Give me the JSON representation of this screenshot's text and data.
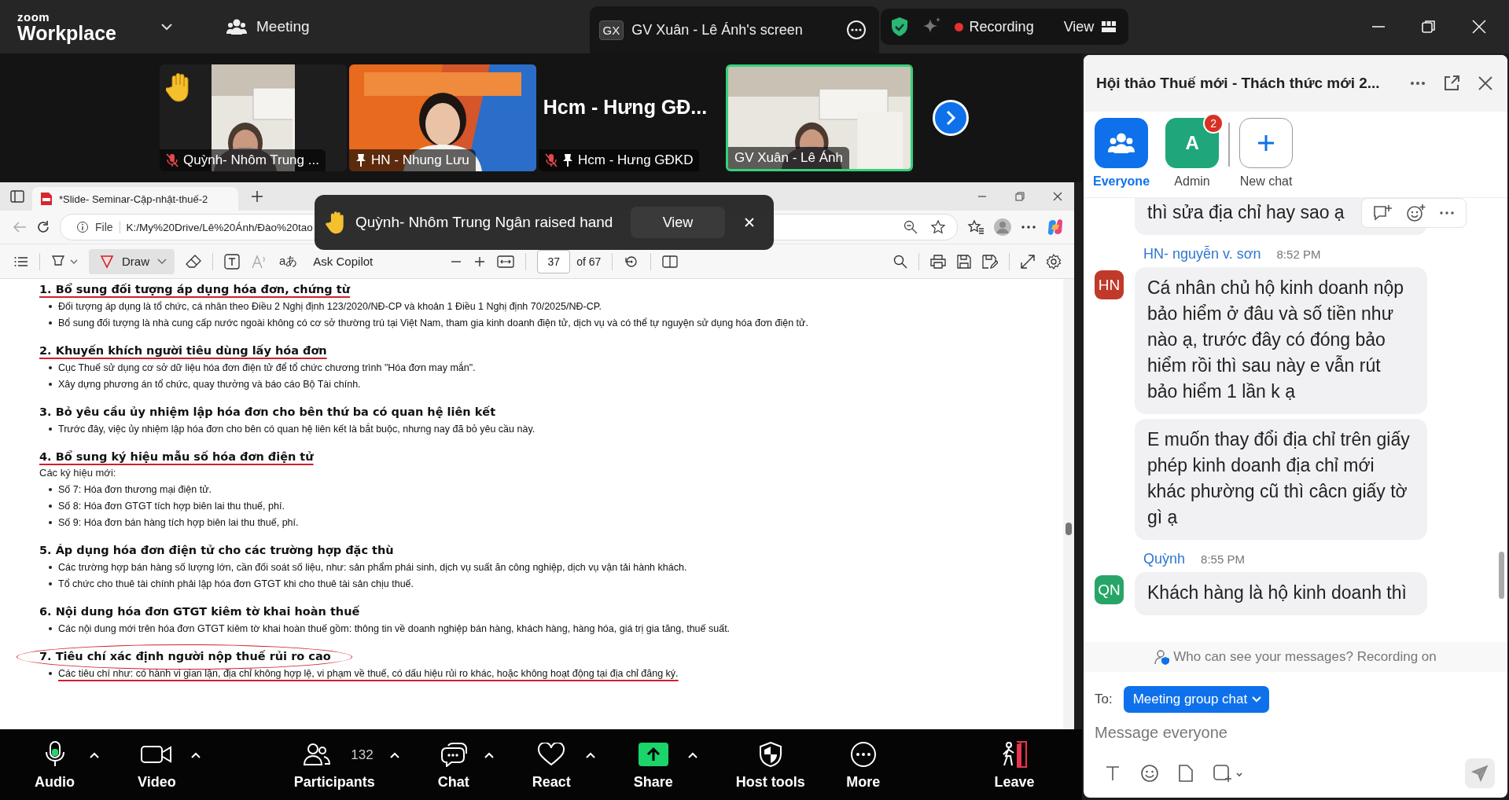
{
  "app": {
    "logo_top": "zoom",
    "logo_bottom": "Workplace",
    "menu": "Meeting",
    "share_tab": {
      "initials": "GX",
      "title": "GV Xuân - Lê Ánh's screen"
    },
    "recording": "Recording",
    "view": "View"
  },
  "thumbnails": [
    {
      "kind": "video",
      "name": "Quỳnh- Nhôm Trung ...",
      "raised_hand": true,
      "muted": true,
      "pinned": false,
      "active": false
    },
    {
      "kind": "video",
      "name": "HN - Nhung Lưu",
      "raised_hand": false,
      "muted": false,
      "pinned": true,
      "active": false
    },
    {
      "kind": "name",
      "display": "Hcm - Hưng GĐ...",
      "name": "Hcm - Hưng GĐKD",
      "raised_hand": false,
      "muted": true,
      "pinned": true,
      "active": false
    },
    {
      "kind": "video",
      "name": "GV Xuân - Lê Ánh",
      "raised_hand": false,
      "muted": false,
      "pinned": false,
      "active": true
    }
  ],
  "browser": {
    "tab_title": "*Slide- Seminar-Cập-nhật-thuế-2",
    "url_label": "File",
    "url": "K:/My%20Drive/Lê%20Ánh/Đào%20tao"
  },
  "pdf_toolbar": {
    "draw": "Draw",
    "read_aloud": "aあ",
    "copilot": "Ask Copilot",
    "page": "37",
    "of_pages": "of 67"
  },
  "toast": {
    "text": "Quỳnh- Nhôm Trung Ngân raised hand",
    "button": "View"
  },
  "sections": [
    {
      "heading": "1. Bổ sung đối tượng áp dụng hóa đơn, chứng từ",
      "underlined": true,
      "circled": false,
      "bullets": [
        {
          "text": "Đối tượng áp dụng là tổ chức, cá nhân theo Điều 2 Nghị định 123/2020/NĐ-CP và khoản 1 Điều 1 Nghị định 70/2025/NĐ-CP.",
          "underlined": false
        },
        {
          "text": "Bổ sung đối tượng là nhà cung cấp nước ngoài không có cơ sở thường trú tại Việt Nam, tham gia kinh doanh điện tử, dịch vụ và có thể tự nguyện sử dụng hóa đơn điện tử.",
          "underlined": false
        }
      ]
    },
    {
      "heading": "2. Khuyến khích người tiêu dùng lấy hóa đơn",
      "underlined": true,
      "circled": false,
      "bullets": [
        {
          "text": "Cục Thuế sử dụng cơ sở dữ liệu hóa đơn điện tử để tổ chức chương trình \"Hóa đơn may mắn\".",
          "underlined": false
        },
        {
          "text": "Xây dựng phương án tổ chức, quay thưởng và báo cáo Bộ Tài chính.",
          "underlined": false
        }
      ]
    },
    {
      "heading": "3. Bỏ yêu cầu ủy nhiệm lập hóa đơn cho bên thứ ba có quan hệ liên kết",
      "underlined": false,
      "circled": false,
      "bullets": [
        {
          "text": "Trước đây, việc ủy nhiệm lập hóa đơn cho bên có quan hệ liên kết là bắt buộc, nhưng nay đã bỏ yêu cầu này.",
          "underlined": false
        }
      ]
    },
    {
      "heading": "4. Bổ sung ký hiệu mẫu số hóa đơn điện tử",
      "underlined": true,
      "circled": false,
      "intro": "Các ký hiệu mới:",
      "bullets": [
        {
          "text": "Số 7: Hóa đơn thương mại điện tử.",
          "underlined": false
        },
        {
          "text": "Số 8: Hóa đơn GTGT tích hợp biên lai thu thuế, phí.",
          "underlined": false
        },
        {
          "text": "Số 9: Hóa đơn bán hàng tích hợp biên lai thu thuế, phí.",
          "underlined": false
        }
      ]
    },
    {
      "heading": "5. Áp dụng hóa đơn điện tử cho các trường hợp đặc thù",
      "underlined": false,
      "circled": false,
      "bullets": [
        {
          "text": "Các trường hợp bán hàng số lượng lớn, cần đối soát số liệu, như: sản phẩm phái sinh, dịch vụ suất ăn công nghiệp, dịch vụ vận tải hành khách.",
          "underlined": false
        },
        {
          "text": "Tổ chức cho thuê tài chính phải lập hóa đơn GTGT khi cho thuê tài sản chịu thuế.",
          "underlined": false
        }
      ]
    },
    {
      "heading": "6. Nội dung hóa đơn GTGT kiêm tờ khai hoàn thuế",
      "underlined": false,
      "circled": false,
      "bullets": [
        {
          "text": "Các nội dung mới trên hóa đơn GTGT kiêm tờ khai hoàn thuế gồm: thông tin về doanh nghiệp bán hàng, khách hàng, hàng hóa, giá trị gia tăng, thuế suất.",
          "underlined": false
        }
      ]
    },
    {
      "heading": "7. Tiêu chí xác định người nộp thuế rủi ro cao",
      "underlined": false,
      "circled": true,
      "bullets": [
        {
          "text": "Các tiêu chí như: có hành vi gian lận, địa chỉ không hợp lệ, vi phạm về thuế, có dấu hiệu rủi ro khác, hoặc không hoạt động tại địa chỉ đăng ký.",
          "underlined": true
        }
      ]
    }
  ],
  "chat": {
    "title": "Hội thảo Thuế mới - Thách thức mới 2...",
    "tabs": [
      {
        "kind": "group",
        "label": "Everyone",
        "selected": true
      },
      {
        "kind": "avatar",
        "initial": "A",
        "badge": "2",
        "label": "Admin",
        "selected": false
      },
      {
        "kind": "new",
        "label": "New chat",
        "selected": false
      }
    ],
    "messages": [
      {
        "text": "thì sửa địa chỉ hay sao ạ"
      },
      {
        "sender": "HN- nguyễn v. sơn",
        "time": "8:52 PM",
        "initials": "HN",
        "color": "#c0392b",
        "text": "Cá nhân chủ hộ kinh doanh nộp bảo hiểm ở đâu và số tiền như nào ạ, trước đây có đóng bảo hiểm rồi thì sau này e vẫn rút bảo hiểm 1 lần k ạ"
      },
      {
        "text": "E muốn thay đổi địa chỉ trên giấy phép kinh doanh địa chỉ mới khác phường cũ thì câcn giấy tờ gì ạ"
      },
      {
        "sender": "Quỳnh",
        "time": "8:55 PM",
        "initials": "QN",
        "color": "#27a567",
        "text": "Khách hàng là hộ kinh doanh thì"
      }
    ],
    "notice": "Who can see your messages? Recording on",
    "to_label": "To:",
    "to": "Meeting group chat",
    "placeholder": "Message everyone"
  },
  "toolbar": [
    {
      "kind": "audio",
      "label": "Audio",
      "caret": true
    },
    {
      "kind": "video",
      "label": "Video",
      "caret": true
    },
    {
      "kind": "participants",
      "label": "Participants",
      "count": "132",
      "caret": true
    },
    {
      "kind": "chat",
      "label": "Chat",
      "caret": true
    },
    {
      "kind": "react",
      "label": "React",
      "caret": true
    },
    {
      "kind": "share",
      "label": "Share",
      "caret": true
    },
    {
      "kind": "host",
      "label": "Host tools",
      "caret": false
    },
    {
      "kind": "more",
      "label": "More",
      "caret": false
    },
    {
      "kind": "leave",
      "label": "Leave",
      "caret": false
    }
  ]
}
